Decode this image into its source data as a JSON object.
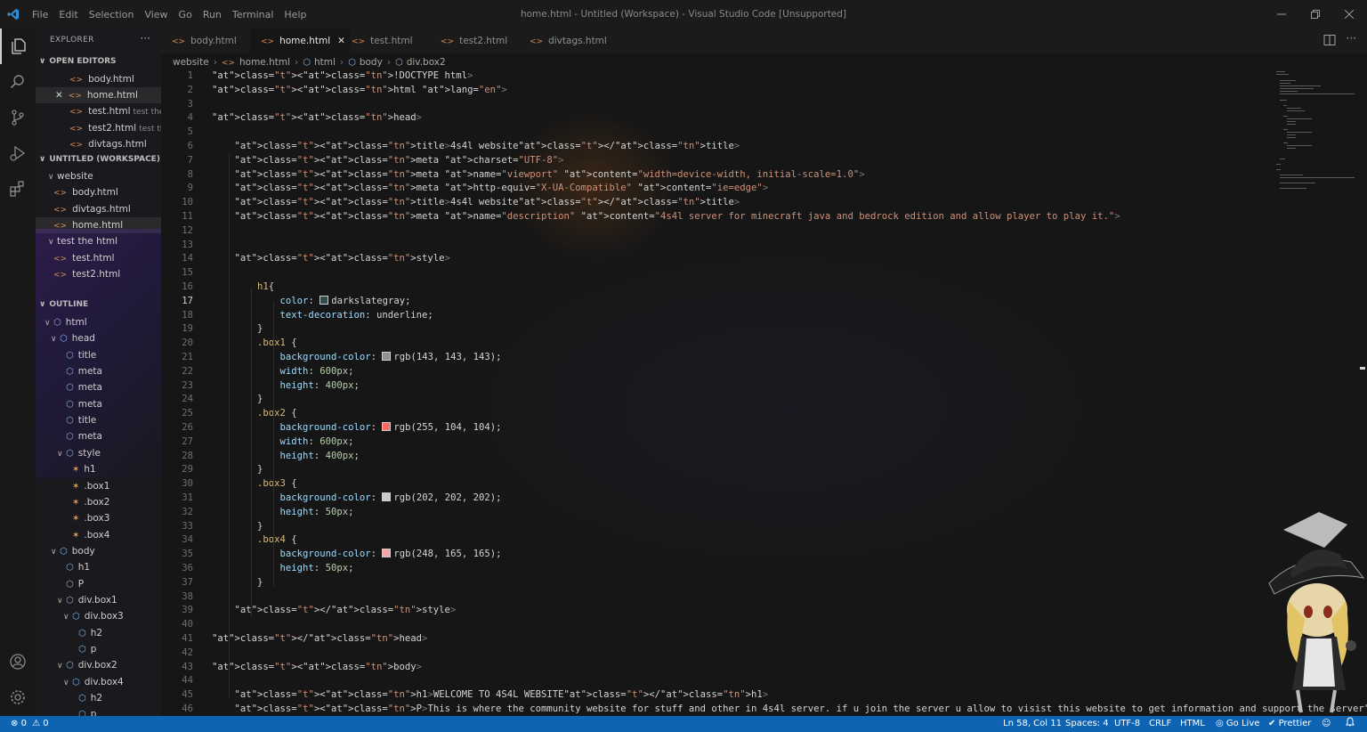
{
  "app": {
    "menu": [
      "File",
      "Edit",
      "Selection",
      "View",
      "Go",
      "Run",
      "Terminal",
      "Help"
    ],
    "window_title": "home.html - Untitled (Workspace) - Visual Studio Code [Unsupported]",
    "window_controls": [
      "minimize-icon",
      "restore-icon",
      "close-icon"
    ]
  },
  "activity_bar": [
    "explorer-icon",
    "search-icon",
    "source-control-icon",
    "run-debug-icon",
    "extensions-icon",
    "account-icon",
    "settings-gear-icon"
  ],
  "sidebar": {
    "title": "EXPLORER",
    "more": "···",
    "open_editors_label": "OPEN EDITORS",
    "open_editors": [
      {
        "name": "body.html",
        "desc": ""
      },
      {
        "name": "home.html",
        "desc": ""
      },
      {
        "name": "test.html",
        "desc": "test the..."
      },
      {
        "name": "test2.html",
        "desc": "test th..."
      },
      {
        "name": "divtags.html",
        "desc": ""
      }
    ],
    "workspace_label": "UNTITLED (WORKSPACE)",
    "workspace": [
      {
        "name": "website",
        "kind": "folder"
      },
      {
        "name": "body.html",
        "kind": "file"
      },
      {
        "name": "divtags.html",
        "kind": "file"
      },
      {
        "name": "home.html",
        "kind": "file"
      },
      {
        "name": "test the html",
        "kind": "folder"
      },
      {
        "name": "test.html",
        "kind": "file"
      },
      {
        "name": "test2.html",
        "kind": "file"
      }
    ],
    "outline_label": "OUTLINE",
    "outline": [
      {
        "name": "html",
        "kind": "el"
      },
      {
        "name": "head",
        "kind": "el"
      },
      {
        "name": "title",
        "kind": "el"
      },
      {
        "name": "meta",
        "kind": "el"
      },
      {
        "name": "meta",
        "kind": "el"
      },
      {
        "name": "meta",
        "kind": "el"
      },
      {
        "name": "title",
        "kind": "el"
      },
      {
        "name": "meta",
        "kind": "el"
      },
      {
        "name": "style",
        "kind": "el"
      },
      {
        "name": "h1",
        "kind": "cls"
      },
      {
        "name": ".box1",
        "kind": "cls"
      },
      {
        "name": ".box2",
        "kind": "cls"
      },
      {
        "name": ".box3",
        "kind": "cls"
      },
      {
        "name": ".box4",
        "kind": "cls"
      },
      {
        "name": "body",
        "kind": "el"
      },
      {
        "name": "h1",
        "kind": "el"
      },
      {
        "name": "P",
        "kind": "el"
      },
      {
        "name": "div.box1",
        "kind": "el"
      },
      {
        "name": "div.box3",
        "kind": "el"
      },
      {
        "name": "h2",
        "kind": "el"
      },
      {
        "name": "p",
        "kind": "el"
      },
      {
        "name": "div.box2",
        "kind": "el"
      },
      {
        "name": "div.box4",
        "kind": "el"
      },
      {
        "name": "h2",
        "kind": "el"
      },
      {
        "name": "p",
        "kind": "el"
      }
    ]
  },
  "tabs": [
    {
      "label": "body.html",
      "active": false
    },
    {
      "label": "home.html",
      "active": true
    },
    {
      "label": "test.html",
      "active": false
    },
    {
      "label": "test2.html",
      "active": false
    },
    {
      "label": "divtags.html",
      "active": false
    }
  ],
  "breadcrumb": [
    "website",
    "home.html",
    "html",
    "body",
    "div.box2"
  ],
  "editor": {
    "current_line": 17,
    "lines": [
      "<!DOCTYPE html>",
      "<html lang=\"en\">",
      "",
      "<head>",
      "",
      "    <title>4s4l website</title>",
      "    <meta charset=\"UTF-8\">",
      "    <meta name=\"viewport\" content=\"width=device-width, initial-scale=1.0\">",
      "    <meta http-equiv=\"X-UA-Compatible\" content=\"ie=edge\">",
      "    <title>4s4l website</title>",
      "    <meta name=\"description\" content=\"4s4l server for minecraft java and bedrock edition and allow player to play it.\">",
      "",
      "",
      "    <style>",
      "",
      "        h1{",
      "            color: darkslategray;",
      "            text-decoration: underline;",
      "        }",
      "        .box1 {",
      "            background-color: rgb(143, 143, 143);",
      "            width: 600px;",
      "            height: 400px;",
      "        }",
      "        .box2 {",
      "            background-color: rgb(255, 104, 104);",
      "            width: 600px;",
      "            height: 400px;",
      "        }",
      "        .box3 {",
      "            background-color: rgb(202, 202, 202);",
      "            height: 50px;",
      "        }",
      "        .box4 {",
      "            background-color: rgb(248, 165, 165);",
      "            height: 50px;",
      "        }",
      "",
      "    </style>",
      "",
      "</head>",
      "",
      "<body>",
      "",
      "    <h1>WELCOME TO 4S4L WEBSITE</h1>",
      "    <P>This is where the community website for stuff and other in 4s4l server. if u join the server u allow to visist this website to get information and support the server</P>"
    ],
    "swatches": {
      "17": "#2f4f4f",
      "21": "#8f8f8f",
      "26": "#ff6868",
      "31": "#cacaca",
      "35": "#f8a5a5"
    }
  },
  "status": {
    "problems": "0",
    "warnings": "0",
    "cursor": "Ln 58, Col 11",
    "spaces": "Spaces: 4",
    "encoding": "UTF-8",
    "eol": "CRLF",
    "language": "HTML",
    "golive": "Go Live",
    "prettier": "Prettier"
  },
  "colors": {
    "accent_statusbar": "#0e63b3",
    "file_icon": "#d98b54",
    "outline_element": "#7fb4e8",
    "outline_class": "#e0a050"
  }
}
